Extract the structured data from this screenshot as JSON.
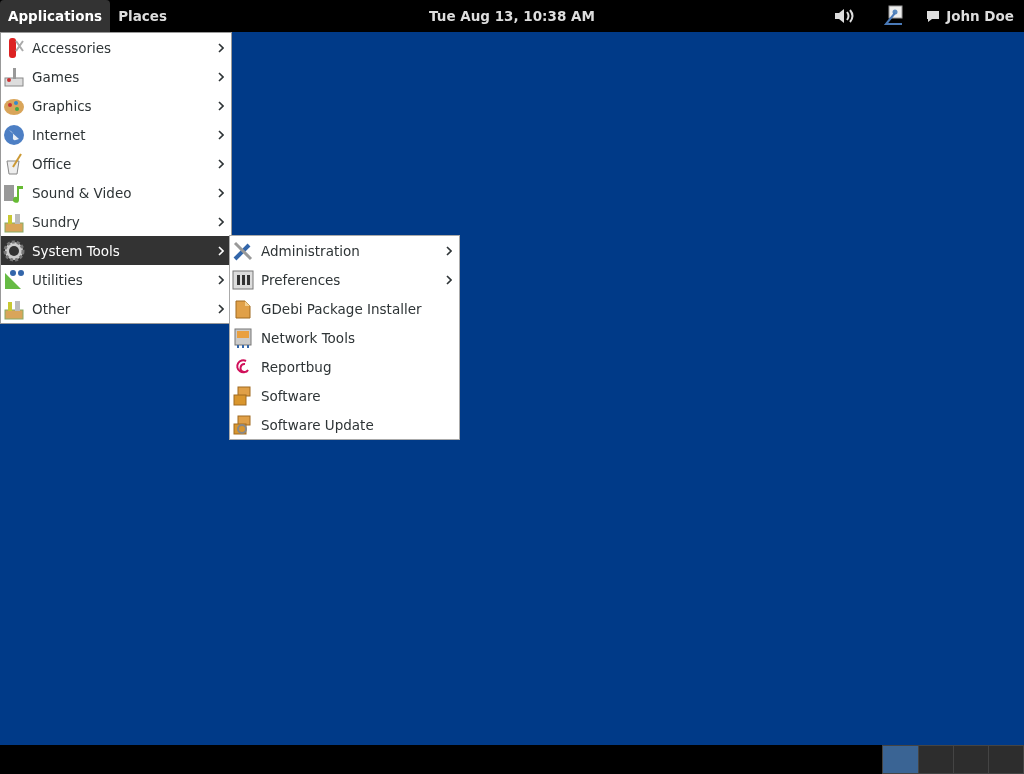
{
  "top_bar": {
    "menus": [
      {
        "label": "Applications",
        "selected": true
      },
      {
        "label": "Places",
        "selected": false
      }
    ],
    "clock": "Tue Aug 13, 10:38 AM",
    "user": "John Doe"
  },
  "applications_menu": {
    "items": [
      {
        "label": "Accessories",
        "submenu": true,
        "selected": false
      },
      {
        "label": "Games",
        "submenu": true,
        "selected": false
      },
      {
        "label": "Graphics",
        "submenu": true,
        "selected": false
      },
      {
        "label": "Internet",
        "submenu": true,
        "selected": false
      },
      {
        "label": "Office",
        "submenu": true,
        "selected": false
      },
      {
        "label": "Sound & Video",
        "submenu": true,
        "selected": false
      },
      {
        "label": "Sundry",
        "submenu": true,
        "selected": false
      },
      {
        "label": "System Tools",
        "submenu": true,
        "selected": true
      },
      {
        "label": "Utilities",
        "submenu": true,
        "selected": false
      },
      {
        "label": "Other",
        "submenu": true,
        "selected": false
      }
    ]
  },
  "system_tools_menu": {
    "items": [
      {
        "label": "Administration",
        "submenu": true,
        "selected": false
      },
      {
        "label": "Preferences",
        "submenu": true,
        "selected": false
      },
      {
        "label": "GDebi Package Installer",
        "submenu": false,
        "selected": false
      },
      {
        "label": "Network Tools",
        "submenu": false,
        "selected": false
      },
      {
        "label": "Reportbug",
        "submenu": false,
        "selected": false
      },
      {
        "label": "Software",
        "submenu": false,
        "selected": false
      },
      {
        "label": "Software Update",
        "submenu": false,
        "selected": false
      }
    ]
  },
  "workspaces": [
    {
      "selected": true
    },
    {
      "selected": false
    },
    {
      "selected": false
    },
    {
      "selected": false
    }
  ]
}
